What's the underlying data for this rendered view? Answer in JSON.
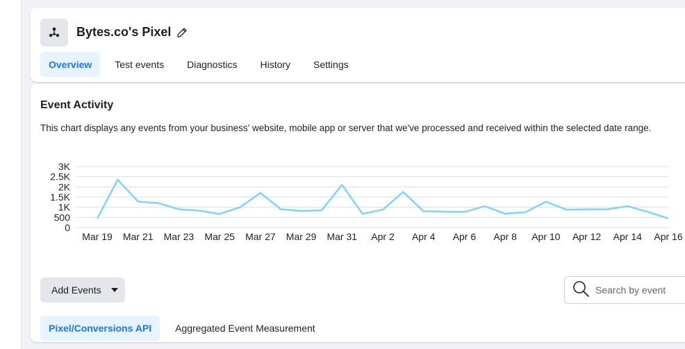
{
  "pixel": {
    "name": "Bytes.co's Pixel",
    "icon": "pixel-network-icon",
    "edit_icon": "pencil-icon"
  },
  "tabs": [
    {
      "label": "Overview",
      "active": true
    },
    {
      "label": "Test events",
      "active": false
    },
    {
      "label": "Diagnostics",
      "active": false
    },
    {
      "label": "History",
      "active": false
    },
    {
      "label": "Settings",
      "active": false
    }
  ],
  "event_activity": {
    "title": "Event Activity",
    "description": "This chart displays any events from your business' website, mobile app or server that we've processed and received within the selected date range."
  },
  "chart_data": {
    "type": "line",
    "title": "",
    "xlabel": "",
    "ylabel": "",
    "ylim": [
      0,
      3000
    ],
    "y_ticks": [
      {
        "value": 0,
        "label": "0"
      },
      {
        "value": 500,
        "label": "500"
      },
      {
        "value": 1000,
        "label": "1K"
      },
      {
        "value": 1500,
        "label": "1.5K"
      },
      {
        "value": 2000,
        "label": "2K"
      },
      {
        "value": 2500,
        "label": "2.5K"
      },
      {
        "value": 3000,
        "label": "3K"
      }
    ],
    "x_tick_labels": [
      "Mar 19",
      "Mar 21",
      "Mar 23",
      "Mar 25",
      "Mar 27",
      "Mar 29",
      "Mar 31",
      "Apr 2",
      "Apr 4",
      "Apr 6",
      "Apr 8",
      "Apr 10",
      "Apr 12",
      "Apr 14",
      "Apr 16"
    ],
    "grid": true,
    "line_color": "#7fd3f7",
    "series": [
      {
        "x": [
          "Mar 19",
          "Mar 20",
          "Mar 21",
          "Mar 22",
          "Mar 23",
          "Mar 24",
          "Mar 25",
          "Mar 26",
          "Mar 27",
          "Mar 28",
          "Mar 29",
          "Mar 30",
          "Mar 31",
          "Apr 1",
          "Apr 2",
          "Apr 3",
          "Apr 4",
          "Apr 5",
          "Apr 6",
          "Apr 7",
          "Apr 8",
          "Apr 9",
          "Apr 10",
          "Apr 11",
          "Apr 12",
          "Apr 13",
          "Apr 14",
          "Apr 15",
          "Apr 16"
        ],
        "values": [
          450,
          2350,
          1280,
          1200,
          900,
          830,
          670,
          1000,
          1700,
          900,
          820,
          850,
          2100,
          680,
          880,
          1750,
          800,
          780,
          770,
          1050,
          680,
          760,
          1270,
          880,
          900,
          900,
          1050,
          770,
          450
        ]
      }
    ]
  },
  "controls": {
    "add_events_label": "Add Events",
    "search_placeholder": "Search by event"
  },
  "sub_tabs": [
    {
      "label": "Pixel/Conversions API",
      "active": true
    },
    {
      "label": "Aggregated Event Measurement",
      "active": false
    }
  ]
}
